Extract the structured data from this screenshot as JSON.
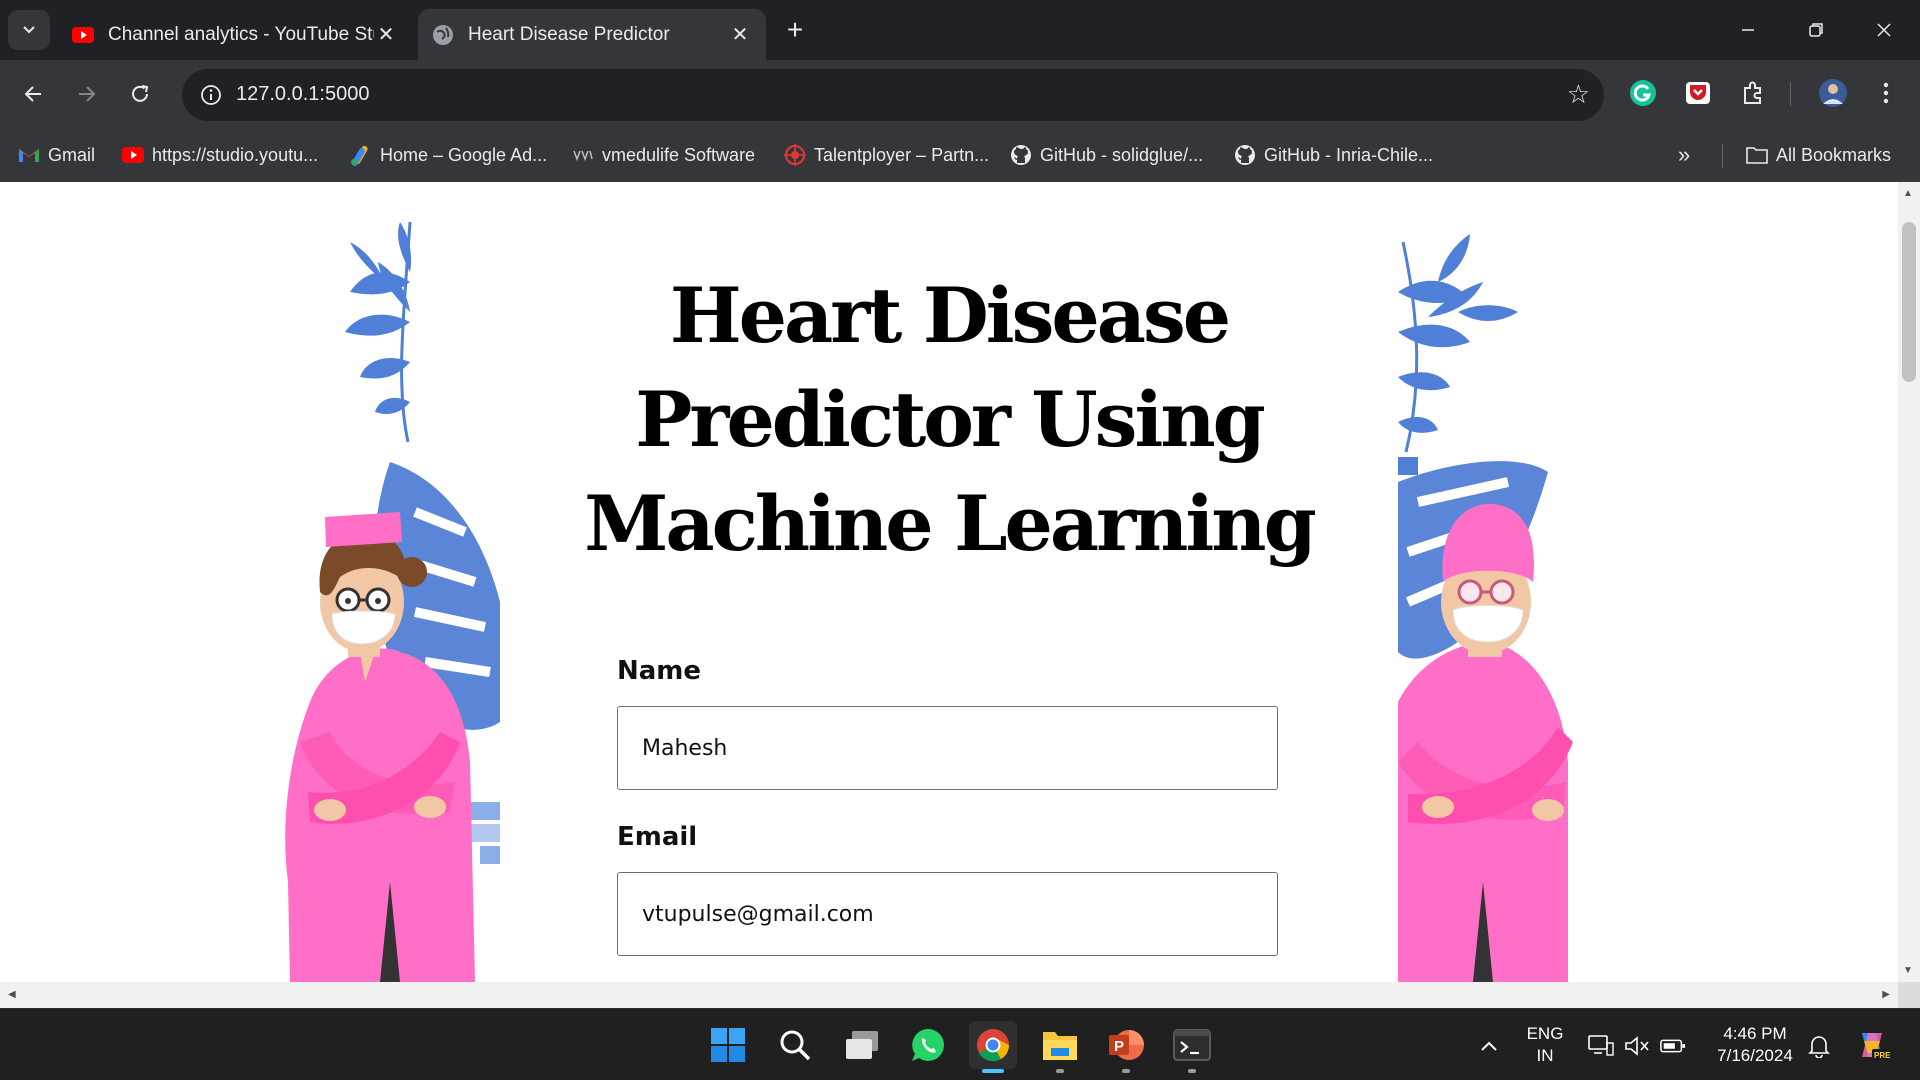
{
  "browser": {
    "tabs": [
      {
        "title": "Channel analytics - YouTube Studio",
        "icon": "youtube-icon",
        "active": false
      },
      {
        "title": "Heart Disease Predictor",
        "icon": "globe-icon",
        "active": true
      }
    ],
    "new_tab_label": "+",
    "url": "127.0.0.1:5000",
    "bookmarks": [
      {
        "label": "Gmail",
        "icon": "gmail-icon"
      },
      {
        "label": "https://studio.youtu...",
        "icon": "youtube-icon"
      },
      {
        "label": "Home – Google Ad...",
        "icon": "google-ads-icon"
      },
      {
        "label": "vmedulife Software",
        "icon": "vmedulife-icon"
      },
      {
        "label": "Talentployer – Partn...",
        "icon": "talentployer-icon"
      },
      {
        "label": "GitHub - solidglue/...",
        "icon": "github-icon"
      },
      {
        "label": "GitHub - Inria-Chile...",
        "icon": "github-icon"
      }
    ],
    "more_bookmarks": "»",
    "all_bookmarks_label": "All Bookmarks"
  },
  "page": {
    "title": "Heart Disease Predictor Using Machine Learning",
    "name_label": "Name",
    "name_value": "Mahesh",
    "email_label": "Email",
    "email_value": "vtupulse@gmail.com"
  },
  "taskbar": {
    "apps": [
      "start-icon",
      "search-icon",
      "task-view-icon",
      "whatsapp-icon",
      "chrome-icon",
      "file-explorer-icon",
      "powerpoint-icon",
      "terminal-icon"
    ],
    "language_line1": "ENG",
    "language_line2": "IN",
    "time": "4:46 PM",
    "date": "7/16/2024"
  },
  "colors": {
    "accent": "#4cc2ff",
    "scrub_pink": "#ff6ec7",
    "leaf_blue": "#4f7fd6"
  }
}
